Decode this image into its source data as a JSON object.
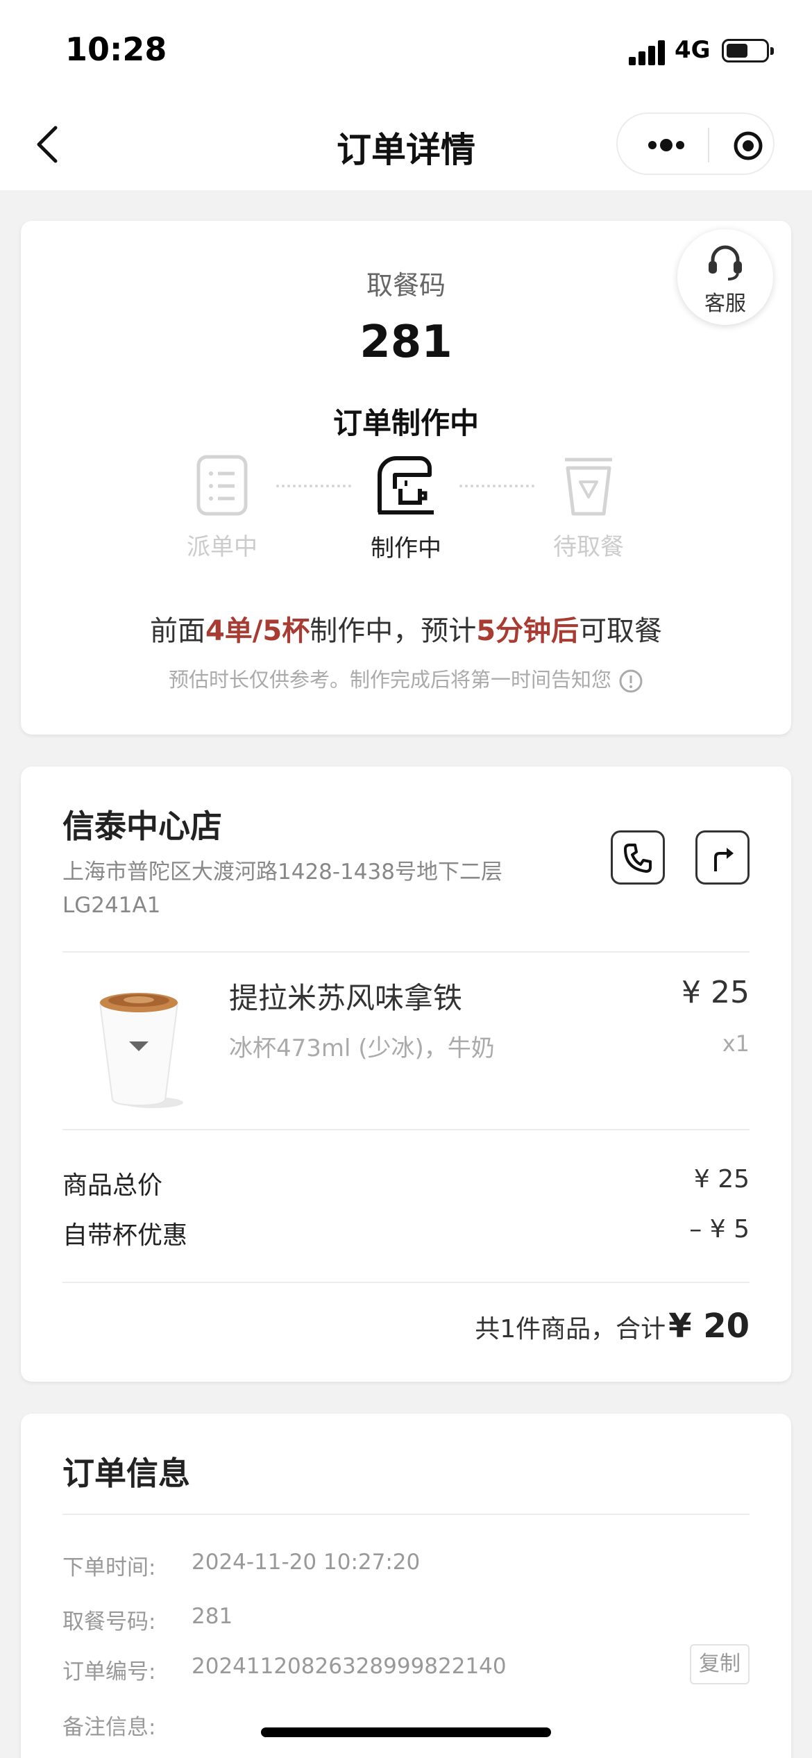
{
  "status_bar": {
    "time": "10:28",
    "network": "4G"
  },
  "nav": {
    "title": "订单详情"
  },
  "pickup": {
    "customer_service_label": "客服",
    "code_label": "取餐码",
    "code": "281",
    "status": "订单制作中",
    "steps": [
      {
        "label": "派单中",
        "icon": "clipboard-icon",
        "active": false
      },
      {
        "label": "制作中",
        "icon": "coffee-machine-icon",
        "active": true
      },
      {
        "label": "待取餐",
        "icon": "cup-icon",
        "active": false
      }
    ],
    "queue_prefix": "前面",
    "queue_count": "4单/5杯",
    "queue_middle": "制作中，预计",
    "queue_time": "5分钟后",
    "queue_suffix": "可取餐",
    "note": "预估时长仅供参考。制作完成后将第一时间告知您"
  },
  "store": {
    "name": "信泰中心店",
    "address": "上海市普陀区大渡河路1428-1438号地下二层LG241A1",
    "product": {
      "name": "提拉米苏风味拿铁",
      "spec": "冰杯473ml (少冰)，牛奶",
      "price": "¥ 25",
      "qty": "x1"
    },
    "summary": [
      {
        "label": "商品总价",
        "value": "¥ 25"
      },
      {
        "label": "自带杯优惠",
        "value": "–  ¥ 5"
      }
    ],
    "total_prefix": "共1件商品，合计",
    "total_amount": "¥ 20"
  },
  "order_info": {
    "title": "订单信息",
    "rows": [
      {
        "label": "下单时间:",
        "value": "2024-11-20 10:27:20"
      },
      {
        "label": "取餐号码:",
        "value": "281"
      },
      {
        "label": "订单编号:",
        "value": "20241120826328999822140"
      },
      {
        "label": "备注信息:",
        "value": ""
      }
    ],
    "copy_label": "复制"
  },
  "colors": {
    "highlight": "#a83c32",
    "muted": "#aaaaaa"
  }
}
